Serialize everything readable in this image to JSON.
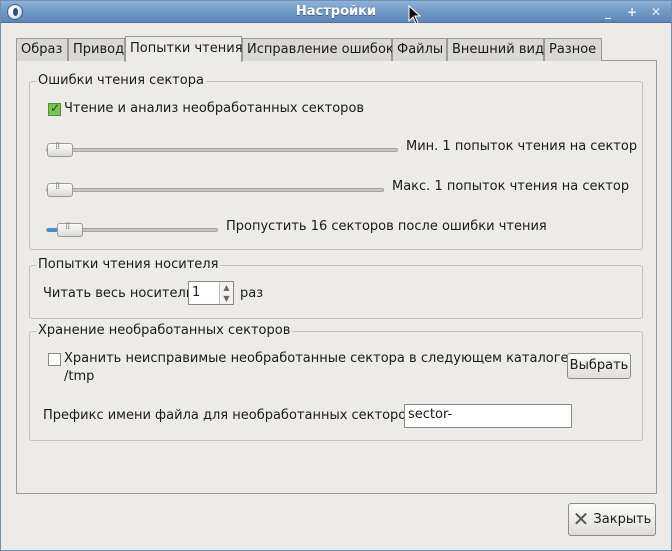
{
  "window": {
    "title": "Настройки"
  },
  "tabs": [
    {
      "label": "Образ"
    },
    {
      "label": "Привод"
    },
    {
      "label": "Попытки чтения"
    },
    {
      "label": "Исправление ошибок"
    },
    {
      "label": "Файлы"
    },
    {
      "label": "Внешний вид"
    },
    {
      "label": "Разное"
    }
  ],
  "sector_errors": {
    "title": "Ошибки чтения сектора",
    "raw_analysis_label": "Чтение и анализ необработанных секторов",
    "raw_analysis_checked": true,
    "min_attempts_label": "Мин. 1 попыток чтения на сектор",
    "min_attempts_value": 1,
    "max_attempts_label": "Макс. 1 попыток чтения на сектор",
    "max_attempts_value": 1,
    "skip_label": "Пропустить 16 секторов после ошибки чтения",
    "skip_value": 16
  },
  "medium_attempts": {
    "title": "Попытки чтения носителя",
    "read_label": "Читать весь носитель",
    "read_value": "1",
    "times_label": "раз"
  },
  "raw_storage": {
    "title": "Хранение необработанных секторов",
    "store_label": "Хранить неисправимые необработанные сектора в следующем каталоге:",
    "store_checked": false,
    "path": "/tmp",
    "choose_button": "Выбрать",
    "prefix_label": "Префикс имени файла для необработанных секторов:",
    "prefix_value": "sector-"
  },
  "footer": {
    "close_button": "Закрыть"
  },
  "colors": {
    "titlebar": "#6f95c4",
    "slider_fill": "#5588c9",
    "check_on": "#7cc05a"
  }
}
